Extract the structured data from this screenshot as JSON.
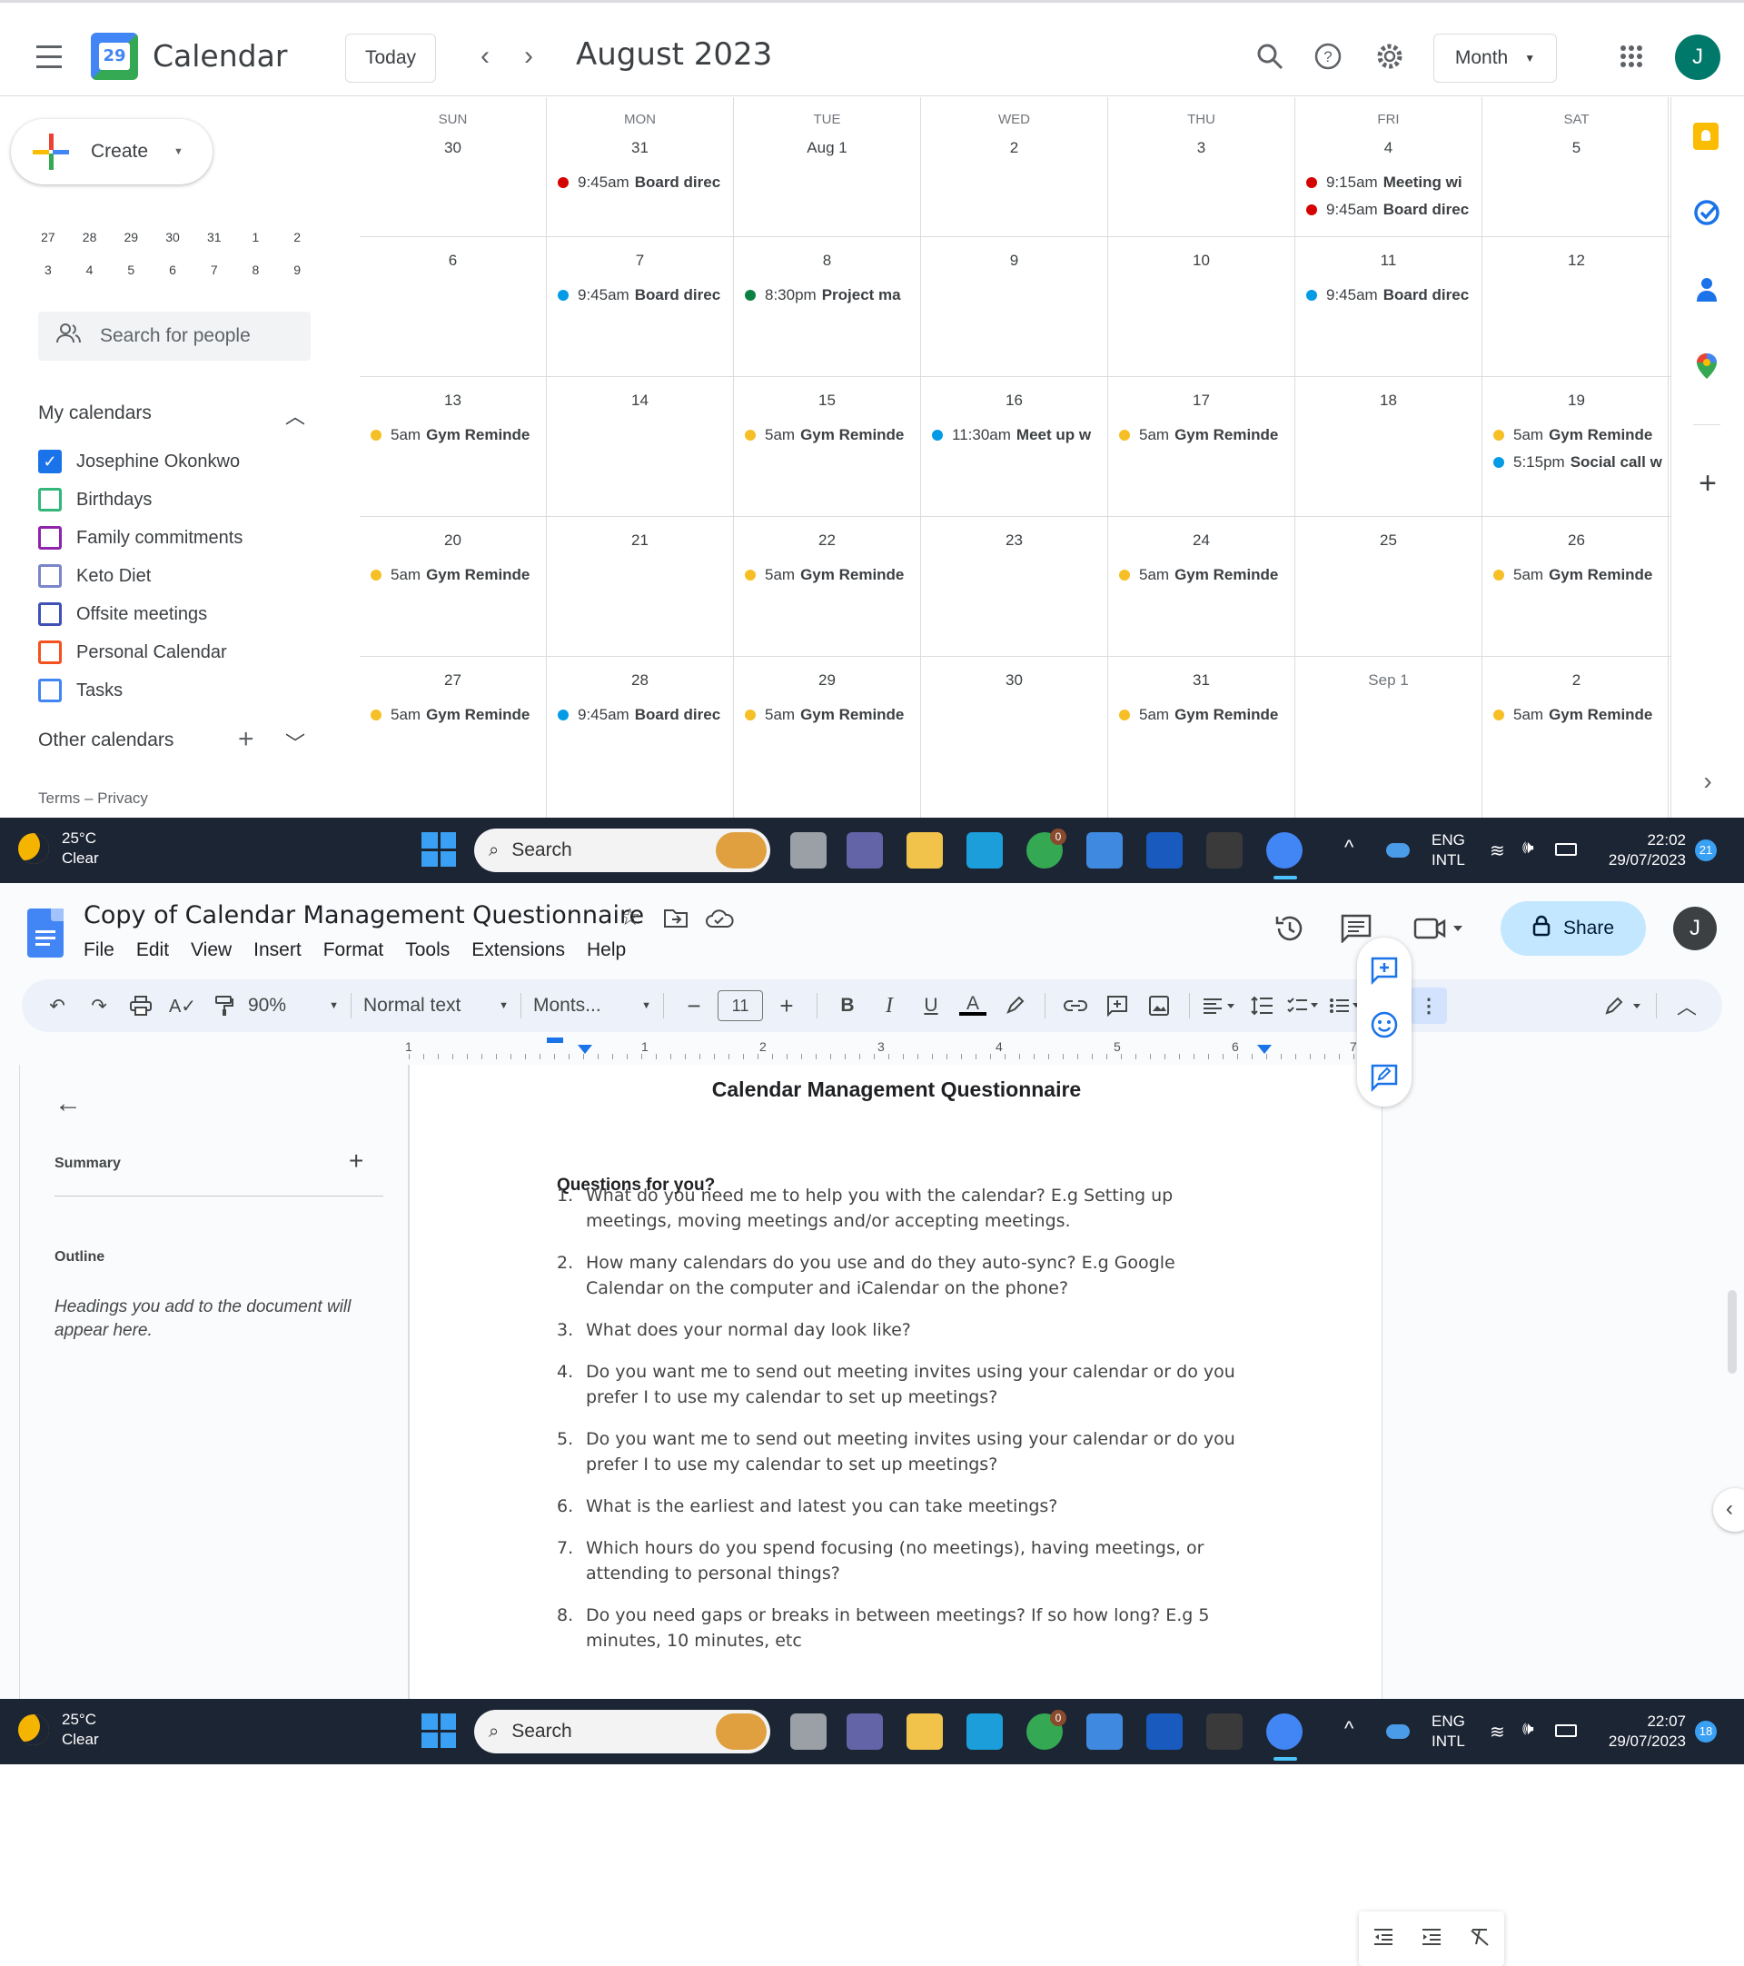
{
  "calendar": {
    "app_title": "Calendar",
    "logo_day": "29",
    "today_label": "Today",
    "period_label": "August 2023",
    "view_label": "Month",
    "avatar_initial": "J",
    "create_label": "Create",
    "mini_calendar_rows": [
      [
        "27",
        "28",
        "29",
        "30",
        "31",
        "1",
        "2"
      ],
      [
        "3",
        "4",
        "5",
        "6",
        "7",
        "8",
        "9"
      ]
    ],
    "search_people_placeholder": "Search for people",
    "my_calendars_label": "My calendars",
    "my_calendars": [
      {
        "name": "Josephine Okonkwo",
        "color": "#1a73e8",
        "checked": true
      },
      {
        "name": "Birthdays",
        "color": "#33b679",
        "checked": false
      },
      {
        "name": "Family commitments",
        "color": "#8e24aa",
        "checked": false
      },
      {
        "name": "Keto Diet",
        "color": "#7986cb",
        "checked": false
      },
      {
        "name": "Offsite meetings",
        "color": "#3f51b5",
        "checked": false
      },
      {
        "name": "Personal Calendar",
        "color": "#f4511e",
        "checked": false
      },
      {
        "name": "Tasks",
        "color": "#4285f4",
        "checked": false
      }
    ],
    "other_calendars_label": "Other calendars",
    "terms_label": "Terms – Privacy",
    "weekdays": [
      "SUN",
      "MON",
      "TUE",
      "WED",
      "THU",
      "FRI",
      "SAT"
    ],
    "weeks": [
      [
        {
          "date": "30",
          "events": []
        },
        {
          "date": "31",
          "events": [
            {
              "time": "9:45am",
              "title": "Board direc",
              "color": "#d50000"
            }
          ]
        },
        {
          "date": "Aug 1",
          "events": []
        },
        {
          "date": "2",
          "events": []
        },
        {
          "date": "3",
          "events": []
        },
        {
          "date": "4",
          "events": [
            {
              "time": "9:15am",
              "title": "Meeting wi",
              "color": "#d50000"
            },
            {
              "time": "9:45am",
              "title": "Board direc",
              "color": "#d50000"
            }
          ]
        },
        {
          "date": "5",
          "events": []
        }
      ],
      [
        {
          "date": "6",
          "events": []
        },
        {
          "date": "7",
          "events": [
            {
              "time": "9:45am",
              "title": "Board direc",
              "color": "#039be5"
            }
          ]
        },
        {
          "date": "8",
          "events": [
            {
              "time": "8:30pm",
              "title": "Project ma",
              "color": "#0b8043"
            }
          ]
        },
        {
          "date": "9",
          "events": []
        },
        {
          "date": "10",
          "events": []
        },
        {
          "date": "11",
          "events": [
            {
              "time": "9:45am",
              "title": "Board direc",
              "color": "#039be5"
            }
          ]
        },
        {
          "date": "12",
          "events": []
        }
      ],
      [
        {
          "date": "13",
          "events": [
            {
              "time": "5am",
              "title": "Gym Reminde",
              "color": "#f6bf26"
            }
          ]
        },
        {
          "date": "14",
          "events": []
        },
        {
          "date": "15",
          "events": [
            {
              "time": "5am",
              "title": "Gym Reminde",
              "color": "#f6bf26"
            }
          ]
        },
        {
          "date": "16",
          "events": [
            {
              "time": "11:30am",
              "title": "Meet up w",
              "color": "#039be5"
            }
          ]
        },
        {
          "date": "17",
          "events": [
            {
              "time": "5am",
              "title": "Gym Reminde",
              "color": "#f6bf26"
            }
          ]
        },
        {
          "date": "18",
          "events": []
        },
        {
          "date": "19",
          "events": [
            {
              "time": "5am",
              "title": "Gym Reminde",
              "color": "#f6bf26"
            },
            {
              "time": "5:15pm",
              "title": "Social call w",
              "color": "#039be5"
            }
          ]
        }
      ],
      [
        {
          "date": "20",
          "events": [
            {
              "time": "5am",
              "title": "Gym Reminde",
              "color": "#f6bf26"
            }
          ]
        },
        {
          "date": "21",
          "events": []
        },
        {
          "date": "22",
          "events": [
            {
              "time": "5am",
              "title": "Gym Reminde",
              "color": "#f6bf26"
            }
          ]
        },
        {
          "date": "23",
          "events": []
        },
        {
          "date": "24",
          "events": [
            {
              "time": "5am",
              "title": "Gym Reminde",
              "color": "#f6bf26"
            }
          ]
        },
        {
          "date": "25",
          "events": []
        },
        {
          "date": "26",
          "events": [
            {
              "time": "5am",
              "title": "Gym Reminde",
              "color": "#f6bf26"
            }
          ]
        }
      ],
      [
        {
          "date": "27",
          "events": [
            {
              "time": "5am",
              "title": "Gym Reminde",
              "color": "#f6bf26"
            }
          ]
        },
        {
          "date": "28",
          "events": [
            {
              "time": "9:45am",
              "title": "Board direc",
              "color": "#039be5"
            }
          ]
        },
        {
          "date": "29",
          "events": [
            {
              "time": "5am",
              "title": "Gym Reminde",
              "color": "#f6bf26"
            }
          ]
        },
        {
          "date": "30",
          "events": []
        },
        {
          "date": "31",
          "events": [
            {
              "time": "5am",
              "title": "Gym Reminde",
              "color": "#f6bf26"
            }
          ]
        },
        {
          "date": "Sep 1",
          "events": []
        },
        {
          "date": "2",
          "events": [
            {
              "time": "5am",
              "title": "Gym Reminde",
              "color": "#f6bf26"
            }
          ]
        }
      ]
    ]
  },
  "taskbar_top": {
    "temp": "25°C",
    "condition": "Clear",
    "search_placeholder": "Search",
    "lang1": "ENG",
    "lang2": "INTL",
    "time": "22:02",
    "date": "29/07/2023",
    "notifications": "21",
    "chrome_badge": "0"
  },
  "taskbar_bottom": {
    "temp": "25°C",
    "condition": "Clear",
    "search_placeholder": "Search",
    "lang1": "ENG",
    "lang2": "INTL",
    "time": "22:07",
    "date": "29/07/2023",
    "notifications": "18",
    "chrome_badge": "0"
  },
  "docs": {
    "title": "Copy of Calendar Management Questionnaire",
    "menu": [
      "File",
      "Edit",
      "View",
      "Insert",
      "Format",
      "Tools",
      "Extensions",
      "Help"
    ],
    "share_label": "Share",
    "avatar_initial": "J",
    "zoom": "90%",
    "style": "Normal text",
    "font": "Monts...",
    "font_size": "11",
    "ruler_numbers": [
      "1",
      "1",
      "2",
      "3",
      "4",
      "5",
      "6",
      "7"
    ],
    "summary_label": "Summary",
    "outline_label": "Outline",
    "outline_hint": "Headings you add to the document will appear here.",
    "doc_heading": "Calendar Management Questionnaire",
    "subheading": "Questions for you?",
    "questions": [
      {
        "n": "1.",
        "lines": [
          "What do you need me to help you with the calendar? E.g Setting up",
          "meetings, moving meetings and/or accepting meetings."
        ]
      },
      {
        "n": "2.",
        "lines": [
          "How many calendars do you use and do they auto-sync? E.g Google",
          "Calendar on the computer and iCalendar on the phone?"
        ]
      },
      {
        "n": "3.",
        "lines": [
          "What does your normal day look like?"
        ]
      },
      {
        "n": "4.",
        "lines": [
          "Do you want me to send out meeting invites using your calendar or do you",
          "prefer I to use my calendar to set up meetings?"
        ]
      },
      {
        "n": "5.",
        "lines": [
          "Do you want me to send out meeting invites using your calendar or do you",
          "prefer I to use my calendar to set up meetings?"
        ]
      },
      {
        "n": "6.",
        "lines": [
          "What is the earliest and latest you can take meetings?"
        ]
      },
      {
        "n": "7.",
        "lines": [
          "Which hours do you spend focusing (no meetings), having meetings, or",
          "attending to personal things?"
        ]
      },
      {
        "n": "8.",
        "lines": [
          "Do you need gaps or breaks in between meetings? If so how long? E.g 5",
          "minutes, 10 minutes, etc"
        ]
      }
    ]
  }
}
